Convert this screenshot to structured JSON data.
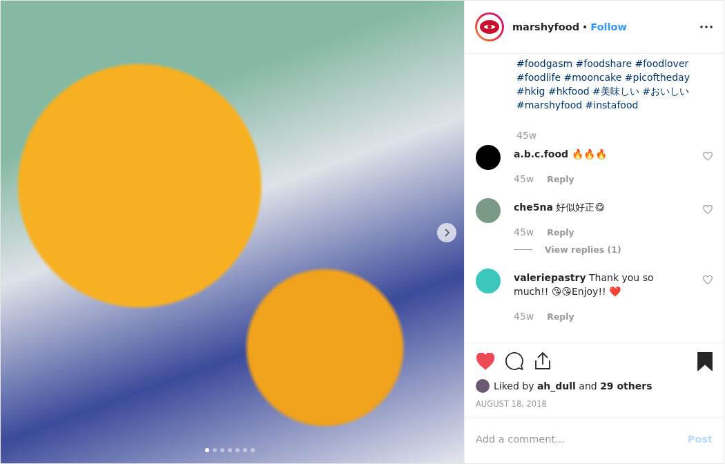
{
  "photo": {
    "dots": [
      {
        "selected": true
      },
      {
        "selected": false
      },
      {
        "selected": false
      },
      {
        "selected": false
      },
      {
        "selected": false
      },
      {
        "selected": false
      },
      {
        "selected": false
      }
    ]
  },
  "header": {
    "username": "marshyfood",
    "separator": "•",
    "follow": "Follow"
  },
  "caption": {
    "lines": [
      "#foodgasm #foodshare #foodlover",
      "#foodlife #mooncake #picoftheday",
      "#hkig #hkfood #美味しい #おいしい",
      "#marshyfood #instafood"
    ],
    "time": "45w"
  },
  "comments": [
    {
      "username": "a.b.c.food",
      "text": "🔥🔥🔥",
      "time": "45w",
      "reply": "Reply",
      "color": "#000000"
    },
    {
      "username": "che5na",
      "text": "好似好正😋",
      "time": "45w",
      "reply": "Reply",
      "color": "#7a9a86",
      "view_replies": "View replies (1)"
    },
    {
      "username": "valeriepastry",
      "text": "Thank you so much!! 😘😘Enjoy!! ❤️",
      "time": "45w",
      "reply": "Reply",
      "color": "#3cc7bd"
    }
  ],
  "actions": {
    "liked": true,
    "saved": true
  },
  "likes": "Liked by **ah_dull** and **29 others**",
  "date": "AUGUST 18, 2018",
  "add_comment": {
    "placeholder": "Add a comment...",
    "post": "Post",
    "disabled": true
  }
}
